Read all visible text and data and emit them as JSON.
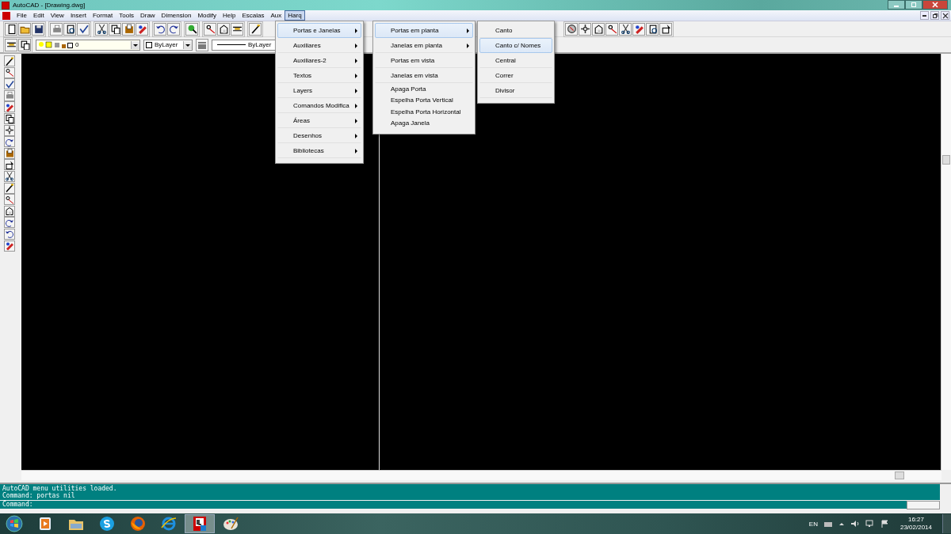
{
  "window": {
    "title": "AutoCAD - [Drawing.dwg]"
  },
  "menu_bar": [
    {
      "label": "File",
      "selected": false
    },
    {
      "label": "Edit",
      "selected": false
    },
    {
      "label": "View",
      "selected": false
    },
    {
      "label": "Insert",
      "selected": false
    },
    {
      "label": "Format",
      "selected": false
    },
    {
      "label": "Tools",
      "selected": false
    },
    {
      "label": "Draw",
      "selected": false
    },
    {
      "label": "Dimension",
      "selected": false
    },
    {
      "label": "Modify",
      "selected": false
    },
    {
      "label": "Help",
      "selected": false
    },
    {
      "label": "Escalas",
      "selected": false
    },
    {
      "label": "Aux",
      "selected": false
    },
    {
      "label": "Harq",
      "selected": true
    }
  ],
  "properties_bar": {
    "layer": "0",
    "color_control": "ByLayer",
    "linetype": "ByLayer"
  },
  "menus": [
    [
      {
        "label": "Portas e Janelas",
        "submenu": true,
        "selected": true,
        "kind": "spaced"
      },
      {
        "label": "Auxiliares",
        "submenu": true,
        "selected": false,
        "kind": "spaced"
      },
      {
        "label": "Auxiliares-2",
        "submenu": true,
        "selected": false,
        "kind": "spaced"
      },
      {
        "label": "Textos",
        "submenu": true,
        "selected": false,
        "kind": "spaced"
      },
      {
        "label": "Layers",
        "submenu": true,
        "selected": false,
        "kind": "spaced"
      },
      {
        "label": "Comandos Modifica",
        "submenu": true,
        "selected": false,
        "kind": "spaced"
      },
      {
        "label": "Áreas",
        "submenu": true,
        "selected": false,
        "kind": "spaced"
      },
      {
        "label": "Desenhos",
        "submenu": true,
        "selected": false,
        "kind": "spaced"
      },
      {
        "label": "Bibliotecas",
        "submenu": true,
        "selected": false,
        "kind": "spaced"
      }
    ],
    [
      {
        "label": "Portas em planta",
        "submenu": true,
        "selected": true,
        "kind": "spaced"
      },
      {
        "label": "Janelas em planta",
        "submenu": true,
        "selected": false,
        "kind": "spaced"
      },
      {
        "label": "Portas em vista",
        "submenu": false,
        "selected": false,
        "kind": "spaced"
      },
      {
        "label": "Janelas em vista",
        "submenu": false,
        "selected": false,
        "kind": "spaced"
      },
      {
        "label": "Apaga Porta",
        "submenu": false,
        "selected": false,
        "kind": "compact"
      },
      {
        "label": "Espelha Porta Vertical",
        "submenu": false,
        "selected": false,
        "kind": "compact"
      },
      {
        "label": "Espelha Porta Horizontal",
        "submenu": false,
        "selected": false,
        "kind": "compact"
      },
      {
        "label": "Apaga Janela",
        "submenu": false,
        "selected": false,
        "kind": "compact"
      }
    ],
    [
      {
        "label": "Canto",
        "submenu": false,
        "selected": false,
        "kind": "spaced"
      },
      {
        "label": "Canto c/ Nomes",
        "submenu": false,
        "selected": true,
        "kind": "spaced"
      },
      {
        "label": "Central",
        "submenu": false,
        "selected": false,
        "kind": "spaced"
      },
      {
        "label": "Correr",
        "submenu": false,
        "selected": false,
        "kind": "spaced"
      },
      {
        "label": "Divisor",
        "submenu": false,
        "selected": false,
        "kind": "spaced"
      }
    ]
  ],
  "command_history": [
    "AutoCAD menu utilities loaded.",
    "Command: portas nil"
  ],
  "command_prompt": "Command:",
  "taskbar": {
    "apps": [
      {
        "kind": "media",
        "selected": false
      },
      {
        "kind": "folder",
        "selected": false
      },
      {
        "kind": "skype",
        "selected": false
      },
      {
        "kind": "firefox",
        "selected": false
      },
      {
        "kind": "browser",
        "selected": false
      },
      {
        "kind": "autocad",
        "selected": true
      },
      {
        "kind": "paint",
        "selected": false
      }
    ],
    "language": "EN",
    "time": "16:27",
    "date": "23/02/2014"
  }
}
